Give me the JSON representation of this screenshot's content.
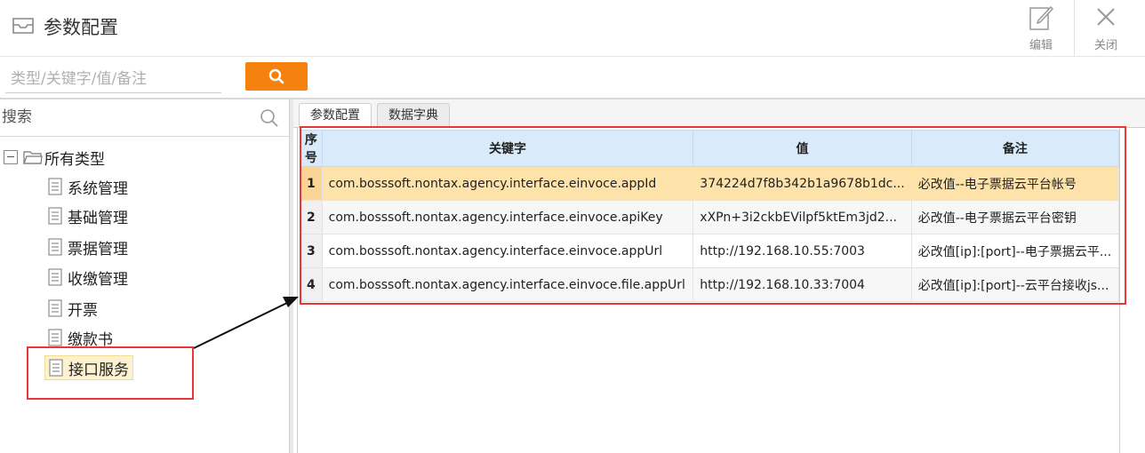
{
  "header": {
    "title": "参数配置",
    "edit_label": "编辑",
    "close_label": "关闭"
  },
  "search": {
    "placeholder": "类型/关键字/值/备注",
    "value": ""
  },
  "sidebar": {
    "search_placeholder": "搜索",
    "root_label": "所有类型",
    "items": [
      {
        "label": "系统管理"
      },
      {
        "label": "基础管理"
      },
      {
        "label": "票据管理"
      },
      {
        "label": "收缴管理"
      },
      {
        "label": "开票"
      },
      {
        "label": "缴款书"
      },
      {
        "label": "接口服务",
        "selected": true
      }
    ]
  },
  "tabs": [
    {
      "label": "参数配置",
      "active": true
    },
    {
      "label": "数据字典",
      "active": false
    }
  ],
  "table": {
    "columns": [
      "序号",
      "关键字",
      "值",
      "备注"
    ],
    "rows": [
      {
        "idx": "1",
        "key": "com.bosssoft.nontax.agency.interface.einvoce.appId",
        "value": "374224d7f8b342b1a9678b1dc...",
        "remark": "必改值--电子票据云平台帐号"
      },
      {
        "idx": "2",
        "key": "com.bosssoft.nontax.agency.interface.einvoce.apiKey",
        "value": "xXPn+3i2ckbEVilpf5ktEm3jd2...",
        "remark": "必改值--电子票据云平台密钥"
      },
      {
        "idx": "3",
        "key": "com.bosssoft.nontax.agency.interface.einvoce.appUrl",
        "value": "http://192.168.10.55:7003",
        "remark": "必改值[ip]:[port]--电子票据云平..."
      },
      {
        "idx": "4",
        "key": "com.bosssoft.nontax.agency.interface.einvoce.file.appUrl",
        "value": "http://192.168.10.33:7004",
        "remark": "必改值[ip]:[port]--云平台接收js..."
      }
    ]
  },
  "colors": {
    "accent": "#f5820f",
    "highlight": "#e53935",
    "header_bg": "#d9eafb",
    "selected_row": "#fde2aa"
  }
}
